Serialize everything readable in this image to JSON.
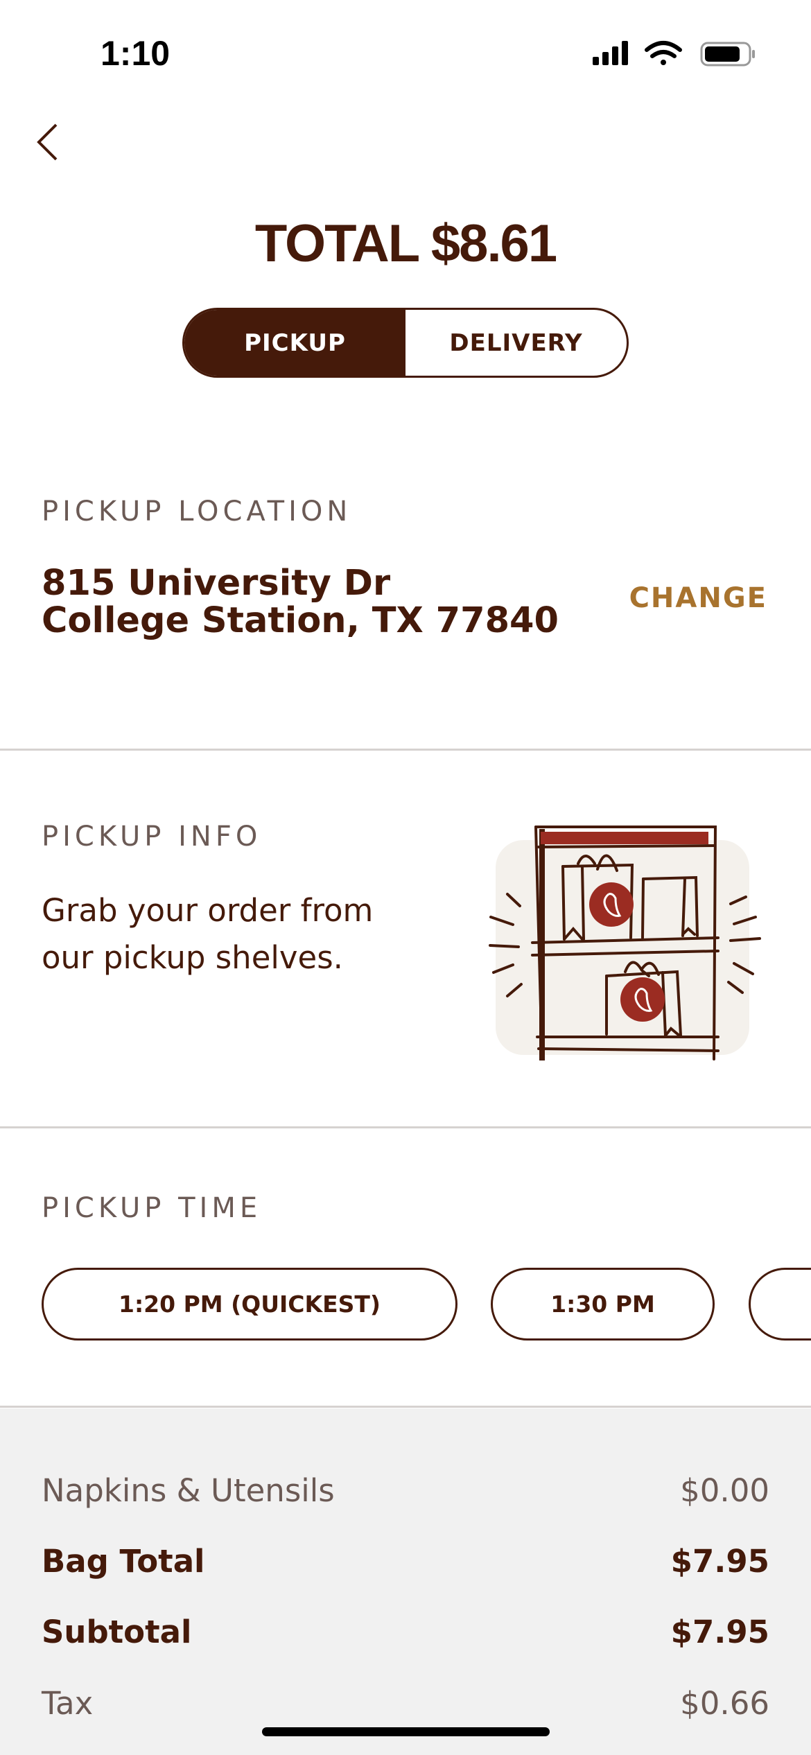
{
  "status_bar": {
    "time": "1:10"
  },
  "header": {
    "total": "TOTAL $8.61",
    "tabs": [
      {
        "label": "PICKUP",
        "active": true
      },
      {
        "label": "DELIVERY",
        "active": false
      }
    ]
  },
  "location": {
    "label": "PICKUP LOCATION",
    "line1": "815 University Dr",
    "line2": "College Station, TX 77840",
    "change": "CHANGE"
  },
  "info": {
    "label": "PICKUP INFO",
    "text_line1": "Grab your order from",
    "text_line2": "our pickup shelves."
  },
  "time": {
    "label": "PICKUP TIME",
    "options": [
      "1:20 PM (QUICKEST)",
      "1:30 PM"
    ]
  },
  "summary": [
    {
      "label": "Napkins & Utensils",
      "value": "$0.00"
    },
    {
      "label": "Bag Total",
      "value": "$7.95"
    },
    {
      "label": "Subtotal",
      "value": "$7.95"
    },
    {
      "label": "Tax",
      "value": "$0.66"
    }
  ],
  "colors": {
    "brand": "#451a0a",
    "accent": "#a8732e",
    "red": "#9b2c22"
  }
}
